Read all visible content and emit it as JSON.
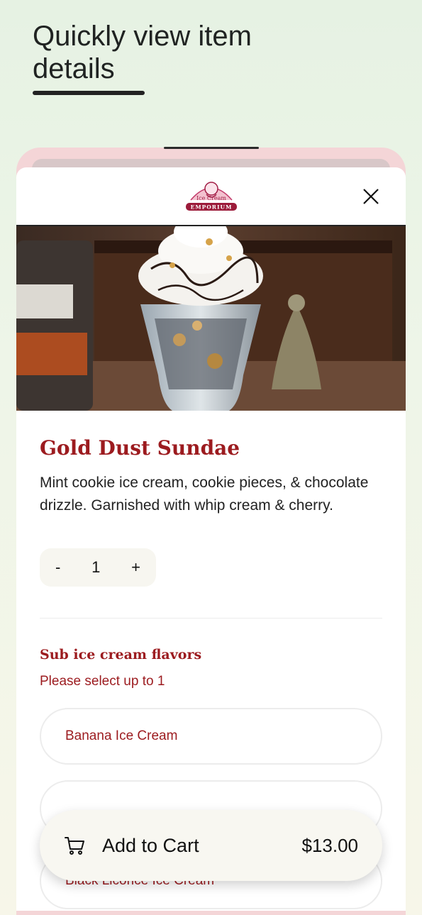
{
  "page": {
    "heading": "Quickly view item details"
  },
  "modal": {
    "logo": {
      "icon": "ice-cream-emporium-logo",
      "text_line1": "Ice Cream",
      "text_line2": "EMPORIUM"
    },
    "close_icon": "close-icon"
  },
  "item": {
    "title": "Gold Dust Sundae",
    "description": "Mint cookie ice cream, cookie pieces, & chocolate drizzle. Garnished with whip cream & cherry.",
    "quantity": {
      "minus": "-",
      "value": "1",
      "plus": "+"
    }
  },
  "section": {
    "title": "Sub ice cream flavors",
    "subtitle": "Please select up to 1",
    "options": [
      {
        "label": "Banana Ice Cream"
      },
      {
        "label": ""
      },
      {
        "label": "Black Licorice Ice Cream"
      }
    ]
  },
  "cart": {
    "label": "Add to Cart",
    "price": "$13.00",
    "icon": "cart-icon"
  },
  "colors": {
    "brand_red": "#9c1b1f",
    "background_green": "#e6f2e3",
    "frame_pink": "#f4d5d7"
  }
}
